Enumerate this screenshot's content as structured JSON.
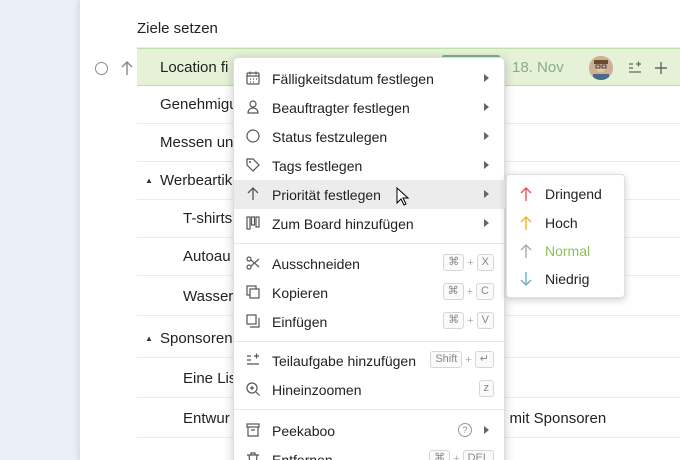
{
  "rows": [
    {
      "text": "Ziele setzen"
    },
    {
      "text": "Location fi"
    },
    {
      "text": "Genehmigu"
    },
    {
      "text": "Messen un"
    },
    {
      "text": "Werbeartik"
    },
    {
      "text": "T-shirts"
    },
    {
      "text": "Autoau"
    },
    {
      "text": "Wasser"
    },
    {
      "text": "Sponsoren"
    },
    {
      "text": "Eine Lis"
    },
    {
      "text": "Entwur"
    }
  ],
  "selected_row": {
    "date": "18. Nov"
  },
  "row_tail_text": "g mit Sponsoren",
  "menu": {
    "items": [
      {
        "label": "Fälligkeitsdatum festlegen",
        "icon": "calendar-icon"
      },
      {
        "label": "Beauftragter festlegen",
        "icon": "person-icon"
      },
      {
        "label": "Status festzulegen",
        "icon": "circle-icon"
      },
      {
        "label": "Tags festlegen",
        "icon": "tag-icon"
      },
      {
        "label": "Priorität festlegen",
        "icon": "arrow-up-icon"
      },
      {
        "label": "Zum Board hinzufügen",
        "icon": "board-icon"
      },
      {
        "label": "Ausschneiden",
        "icon": "scissors-icon",
        "keys": [
          "⌘",
          "X"
        ]
      },
      {
        "label": "Kopieren",
        "icon": "copy-icon",
        "keys": [
          "⌘",
          "C"
        ]
      },
      {
        "label": "Einfügen",
        "icon": "paste-icon",
        "keys": [
          "⌘",
          "V"
        ]
      },
      {
        "label": "Teilaufgabe hinzufügen",
        "icon": "subtask-icon",
        "keys": [
          "Shift",
          "↵"
        ]
      },
      {
        "label": "Hineinzoomen",
        "icon": "zoom-icon",
        "keys": [
          "z"
        ]
      },
      {
        "label": "Peekaboo",
        "icon": "archive-icon"
      },
      {
        "label": "Entfernen",
        "icon": "trash-icon",
        "keys": [
          "⌘",
          "DEL"
        ]
      }
    ],
    "help_glyph": "?"
  },
  "priority_submenu": {
    "items": [
      {
        "label": "Dringend",
        "color": "#e8545a",
        "dir": "up"
      },
      {
        "label": "Hoch",
        "color": "#f0b429",
        "dir": "up"
      },
      {
        "label": "Normal",
        "color": "#8cbf5a",
        "dir": "up"
      },
      {
        "label": "Niedrig",
        "color": "#6aaecf",
        "dir": "down"
      }
    ]
  },
  "colors": {
    "selected_row_bg": "#e5f2d8",
    "accent_green": "#8cbf5a"
  }
}
